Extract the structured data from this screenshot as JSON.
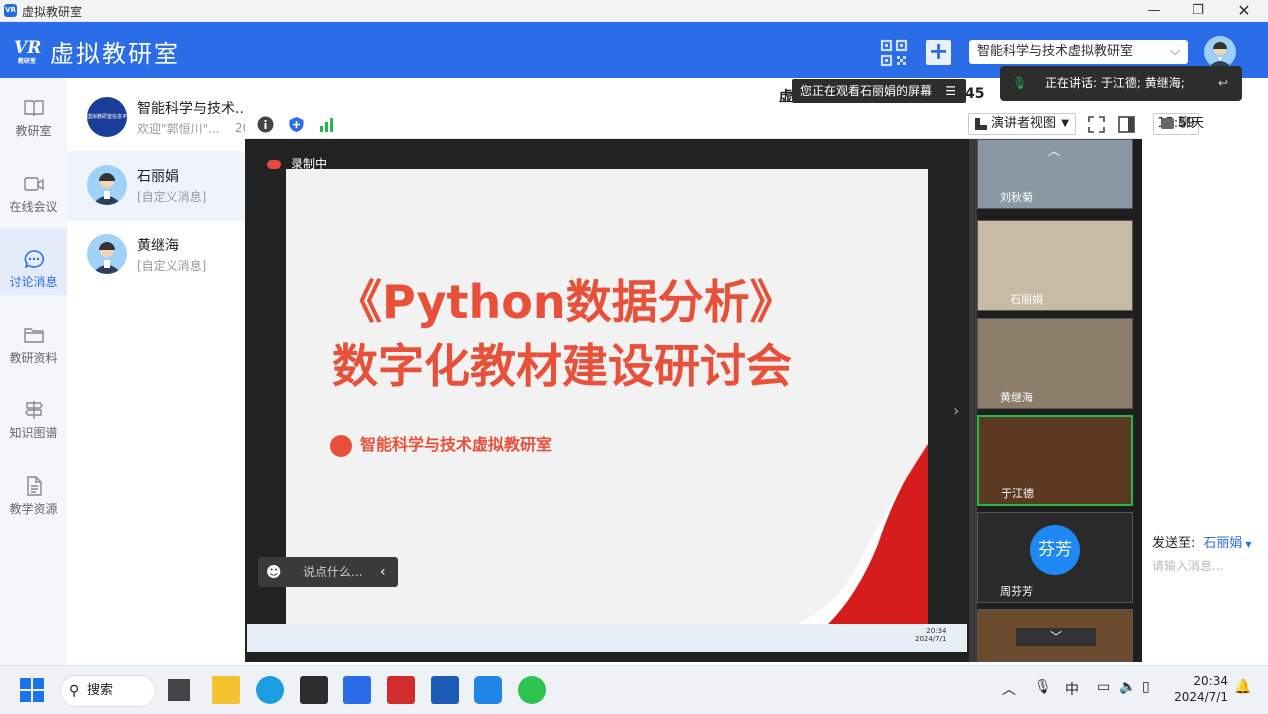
{
  "window": {
    "title": "虚拟教研室",
    "app_badge": "VR"
  },
  "header": {
    "logo_mark": "VR",
    "logo_sub": "教研室",
    "logo_text": "虚拟教研室",
    "room_select": "智能科学与技术虚拟教研室"
  },
  "nav": [
    {
      "label": "教研室",
      "icon": "book-icon"
    },
    {
      "label": "在线会议",
      "icon": "video-camera-icon"
    },
    {
      "label": "讨论消息",
      "icon": "chat-bubble-icon"
    },
    {
      "label": "教研资料",
      "icon": "folder-icon"
    },
    {
      "label": "知识图谱",
      "icon": "signpost-icon"
    },
    {
      "label": "教学资源",
      "icon": "document-icon"
    }
  ],
  "conversations": [
    {
      "name": "智能科学与技术...",
      "message": "欢迎\"郭恒川\"...",
      "time": "20",
      "avatar_text": "虚拟教研室信息平台"
    },
    {
      "name": "石丽娟",
      "message": "[自定义消息]"
    },
    {
      "name": "黄继海",
      "message": "[自定义消息]"
    }
  ],
  "meeting": {
    "title_partial": "虚",
    "title_tail": "45",
    "watching_tooltip": "您正在观看石丽娟的屏幕",
    "speaking_text": "正在讲话: 于江德; 黄继海;",
    "clock": "15:59",
    "view_mode": "演讲者视图",
    "chat_tab": "聊天",
    "recording": "录制中"
  },
  "slide": {
    "title_line1": "《Python数据分析》",
    "title_line2": "数字化教材建设研讨会",
    "org": "智能科学与技术虚拟教研室",
    "comment_placeholder": "说点什么...",
    "inner_time": "20:34",
    "inner_date": "2024/7/1"
  },
  "participants": [
    {
      "name": "刘秋菊",
      "bg": "#7f8e9c"
    },
    {
      "name": "石丽娟",
      "bg": "#c8bba6"
    },
    {
      "name": "黄继海",
      "bg": "#8b7d6a"
    },
    {
      "name": "于江德",
      "bg": "#5b3a21"
    },
    {
      "name": "周芬芳",
      "avatar_text": "芬芳",
      "bg": "#2a2a2a"
    },
    {
      "name": "",
      "bg": "#6b4b2e"
    }
  ],
  "chat": {
    "send_to_label": "发送至:",
    "send_to_value": "石丽娟",
    "input_placeholder": "请输入消息..."
  },
  "taskbar": {
    "search": "搜索",
    "ime": "中",
    "time": "20:34",
    "date": "2024/7/1"
  },
  "colors": {
    "brand": "#2b6de8",
    "slide_red": "#e9503a",
    "speaking_green": "#23b84a"
  }
}
